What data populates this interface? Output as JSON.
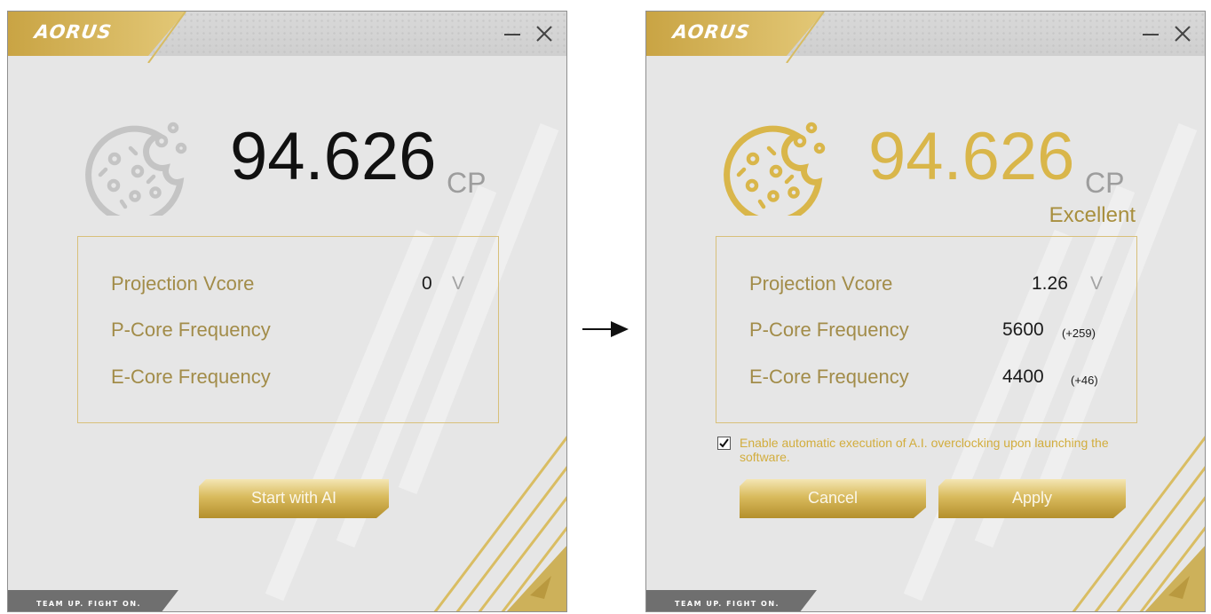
{
  "colors": {
    "gold": "#d9b64a",
    "gold_text": "#a28c49",
    "gray_icon": "#c4c4c4"
  },
  "flow_arrow_icon": "right-arrow-icon",
  "windows": [
    {
      "id": "before",
      "logo": "AORUS",
      "score": "94.626",
      "score_unit": "CP",
      "rows": [
        {
          "label": "Projection Vcore",
          "value": "0",
          "unit": "V"
        },
        {
          "label": "P-Core Frequency"
        },
        {
          "label": "E-Core Frequency"
        }
      ],
      "start_button": "Start with AI",
      "footer": "TEAM UP. FIGHT ON."
    },
    {
      "id": "after",
      "logo": "AORUS",
      "score": "94.626",
      "score_unit": "CP",
      "rating": "Excellent",
      "rows": [
        {
          "label": "Projection Vcore",
          "value": "1.26",
          "unit": "V"
        },
        {
          "label": "P-Core Frequency",
          "value": "5600",
          "delta": "(+259)"
        },
        {
          "label": "E-Core Frequency",
          "value": "4400",
          "delta": "(+46)"
        }
      ],
      "checkbox": {
        "checked": true,
        "label": "Enable automatic execution of A.I. overclocking upon launching the software."
      },
      "cancel_button": "Cancel",
      "apply_button": "Apply",
      "footer": "TEAM UP. FIGHT ON."
    }
  ]
}
